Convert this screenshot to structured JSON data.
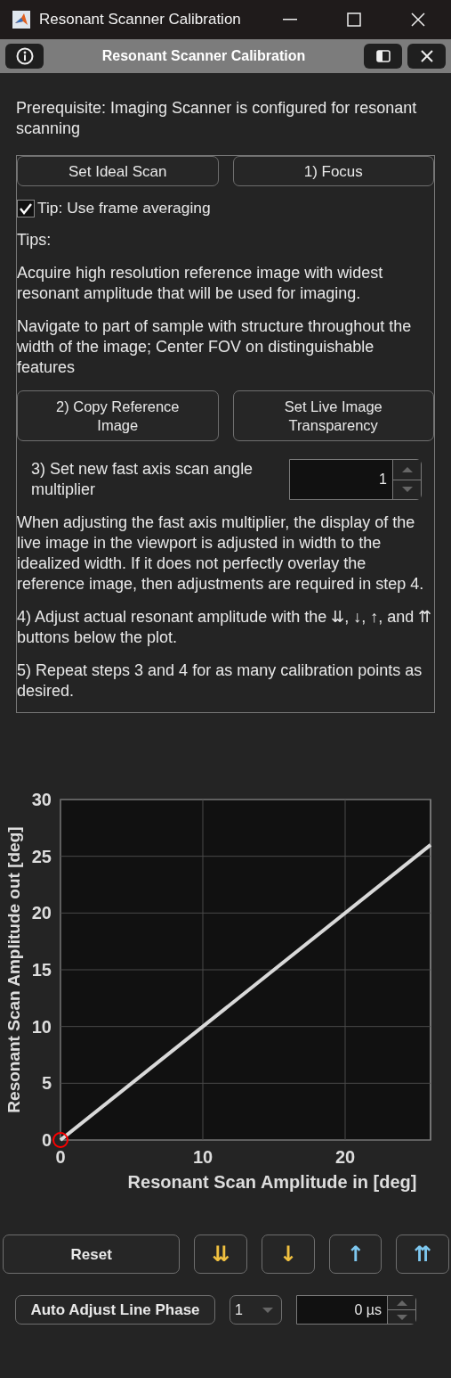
{
  "window": {
    "title": "Resonant Scanner Calibration"
  },
  "toolbar": {
    "title": "Resonant Scanner Calibration"
  },
  "prerequisite": "Prerequisite: Imaging Scanner is configured for resonant scanning",
  "panel": {
    "top_buttons": [
      "Set Ideal Scan",
      "1) Focus"
    ],
    "tip_checkbox": {
      "label": "Tip: Use frame averaging",
      "checked": true
    },
    "tips_heading": "Tips:",
    "tips": [
      "Acquire high resolution reference image with widest resonant amplitude that will be used for imaging.",
      "Navigate to part of sample with structure throughout the width of the image; Center FOV on distinguishable features"
    ],
    "image_buttons": [
      "2) Copy Reference Image",
      "Set Live Image Transparency"
    ],
    "multiplier": {
      "label": "3) Set new fast axis scan angle multiplier",
      "value": "1"
    },
    "notes": [
      "When adjusting the fast axis multiplier, the display of the live image in the viewport is adjusted in width to the idealized width. If it does not perfectly overlay the reference image, then adjustments are required in step 4.",
      "4) Adjust actual resonant amplitude with the ⇊, ↓, ↑, and ⇈ buttons below the plot.",
      "5) Repeat steps 3 and 4 for as many calibration points as desired."
    ]
  },
  "plot": {
    "chart_data": {
      "type": "line",
      "xlabel": "Resonant Scan Amplitude in [deg]",
      "ylabel": "Resonant Scan Amplitude out [deg]",
      "x": [
        0,
        26
      ],
      "xlim": [
        0,
        26
      ],
      "ylim": [
        0,
        30
      ],
      "xticks": [
        0,
        10,
        20
      ],
      "yticks": [
        0,
        5,
        10,
        15,
        20,
        25,
        30
      ],
      "grid": true,
      "series": [
        {
          "color": "#d9d9d9",
          "values": [
            0,
            26
          ]
        },
        {
          "color": "#ff0000",
          "marker": "o",
          "values": [
            0,
            null
          ]
        }
      ]
    }
  },
  "adjust_buttons": [
    {
      "label": "Reset",
      "color": "#e8e8e8"
    },
    {
      "label": "⇊",
      "color": "#f0c040"
    },
    {
      "label": "↓",
      "color": "#f0c040"
    },
    {
      "label": "↑",
      "color": "#7ec8f0"
    },
    {
      "label": "⇈",
      "color": "#7ec8f0"
    }
  ],
  "line_phase": {
    "button": "Auto Adjust Line Phase",
    "step": "1",
    "value": "0 µs"
  }
}
